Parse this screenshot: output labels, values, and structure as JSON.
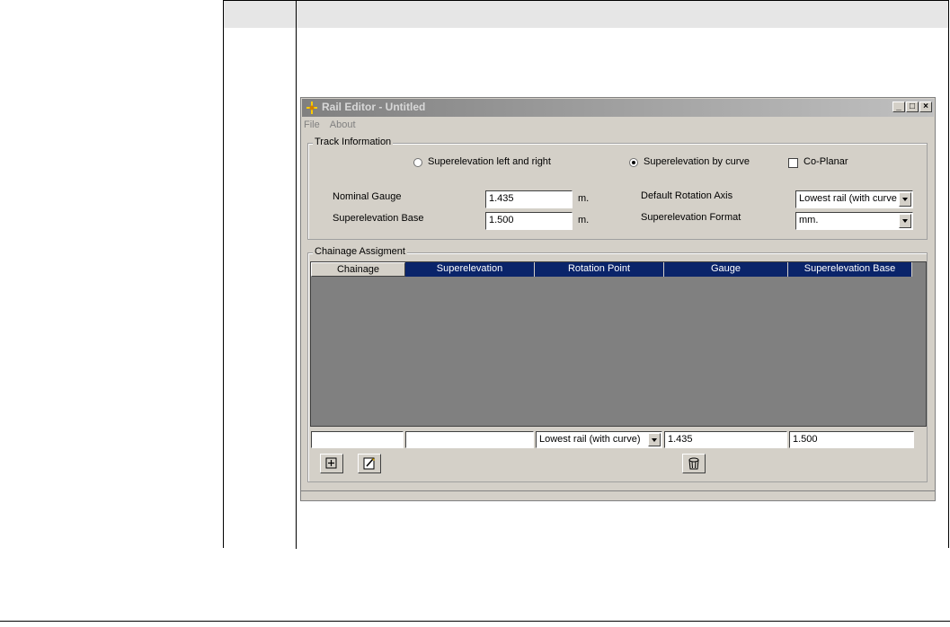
{
  "window": {
    "title": "Rail Editor - Untitled",
    "controls": {
      "minimize": "_",
      "maximize": "□",
      "close": "×"
    }
  },
  "menu": [
    "File",
    "About"
  ],
  "track_information": {
    "legend": "Track Information",
    "options": {
      "superelevation_left_right": "Superelevation left and right",
      "superelevation_by_curve": "Superelevation by curve",
      "co_planar": "Co-Planar"
    },
    "selected_option": "superelevation_by_curve",
    "nominal_gauge": {
      "label": "Nominal Gauge",
      "value": "1.435",
      "unit": "m."
    },
    "superelevation_base": {
      "label": "Superelevation Base",
      "value": "1.500",
      "unit": "m."
    },
    "default_rotation_axis": {
      "label": "Default Rotation Axis",
      "value": "Lowest rail (with curve"
    },
    "superelevation_format": {
      "label": "Superelevation Format",
      "value": "mm."
    }
  },
  "chainage": {
    "legend": "Chainage Assigment",
    "columns": [
      "Chainage",
      "Superelevation",
      "Rotation Point",
      "Gauge",
      "Superelevation Base"
    ],
    "entry": {
      "chainage": "",
      "superelevation": "",
      "rotation_point": "Lowest rail (with curve)",
      "gauge": "1.435",
      "superelevation_base": "1.500"
    }
  },
  "icons": [
    "add-icon",
    "edit-icon",
    "delete-icon"
  ]
}
